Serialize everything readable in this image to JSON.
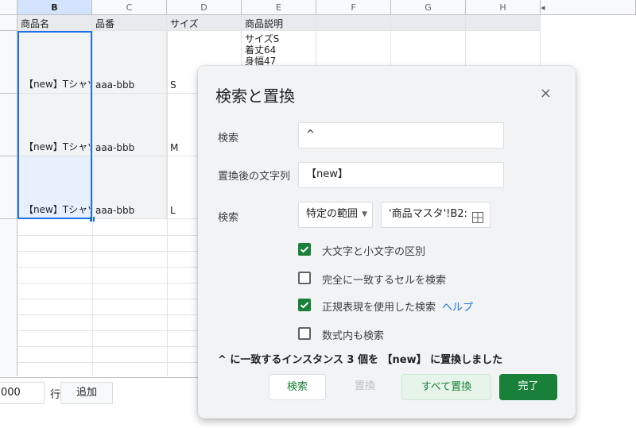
{
  "sheet": {
    "columns": [
      "B",
      "C",
      "D",
      "E",
      "F",
      "G",
      "H"
    ],
    "headers": [
      "商品名",
      "品番",
      "サイズ",
      "商品説明"
    ],
    "rows": [
      {
        "name": "【new】Tシャツ",
        "code": "aaa-bbb",
        "size": "S",
        "desc": [
          "サイズS",
          "着丈64",
          "身幅47"
        ]
      },
      {
        "name": "【new】Tシャツ",
        "code": "aaa-bbb",
        "size": "M"
      },
      {
        "name": "【new】Tシャツ",
        "code": "aaa-bbb",
        "size": "L"
      }
    ],
    "add_rows": {
      "count": "000",
      "unit": "行",
      "button": "追加"
    },
    "scroll_arrow": "◂"
  },
  "dialog": {
    "title": "検索と置換",
    "close": "×",
    "search_label": "検索",
    "search_value": "^",
    "replace_label": "置換後の文字列",
    "replace_value": "【new】",
    "scope_label": "検索",
    "scope_select": "特定の範囲",
    "range_value": "'商品マスタ'!B2:",
    "options": [
      {
        "label": "大文字と小文字の区別",
        "checked": true
      },
      {
        "label": "完全に一致するセルを検索",
        "checked": false
      },
      {
        "label": "正規表現を使用した検索",
        "checked": true,
        "link": "ヘルプ"
      },
      {
        "label": "数式内も検索",
        "checked": false
      }
    ],
    "status": "^ に一致するインスタンス 3 個を 【new】 に置換しました",
    "buttons": {
      "search": "検索",
      "replace": "置換",
      "replace_all": "すべて置換",
      "done": "完了"
    },
    "colors": {
      "accent_green": "#188038",
      "link_blue": "#1a73e8"
    }
  }
}
